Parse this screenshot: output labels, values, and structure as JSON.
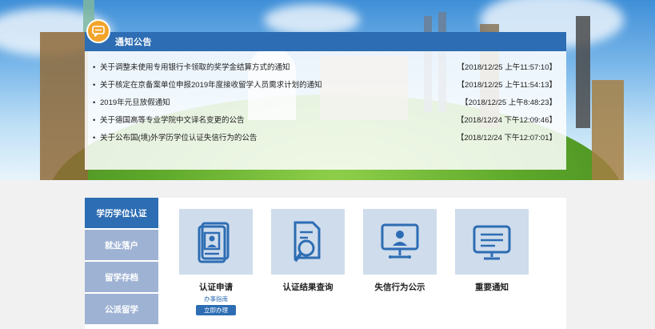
{
  "notice": {
    "title": "通知公告",
    "icon": "chat-bubble-icon",
    "items": [
      {
        "bullet": "•",
        "title": "关于调整未使用专用银行卡领取的奖学金结算方式的通知",
        "date": "【2018/12/25 上午11:57:10】"
      },
      {
        "bullet": "•",
        "title": "关于核定在京备案单位申报2019年度接收留学人员需求计划的通知",
        "date": "【2018/12/25 上午11:54:13】"
      },
      {
        "bullet": "•",
        "title": "2019年元旦放假通知",
        "date": "【2018/12/25 上午8:48:23】"
      },
      {
        "bullet": "•",
        "title": "关于德国高等专业学院中文译名变更的公告",
        "date": "【2018/12/24 下午12:09:46】"
      },
      {
        "bullet": "•",
        "title": "关于公布国(境)外学历学位认证失信行为的公告",
        "date": "【2018/12/24 下午12:07:01】"
      }
    ]
  },
  "sidebar": {
    "tabs": [
      {
        "label": "学历学位认证",
        "active": true
      },
      {
        "label": "就业落户",
        "active": false
      },
      {
        "label": "留学存档",
        "active": false
      },
      {
        "label": "公派留学",
        "active": false
      }
    ]
  },
  "cards": [
    {
      "label": "认证申请",
      "icon": "id-card-icon",
      "sub": "办事指南",
      "button": "立即办理"
    },
    {
      "label": "认证结果查询",
      "icon": "document-search-icon"
    },
    {
      "label": "失信行为公示",
      "icon": "monitor-user-icon"
    },
    {
      "label": "重要通知",
      "icon": "notice-board-icon"
    }
  ],
  "colors": {
    "primary": "#2d6db3",
    "sidebar_inactive": "#9eb2d3",
    "card_bg": "#cfdcec",
    "badge": "#f2a42a"
  }
}
